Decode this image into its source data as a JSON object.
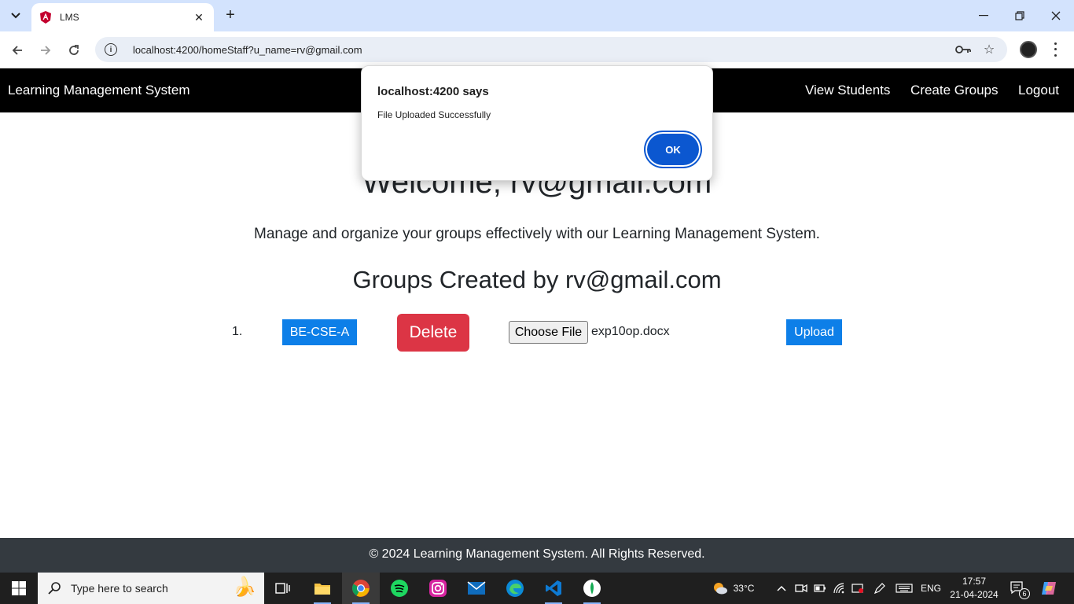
{
  "browser": {
    "tab_title": "LMS",
    "url": "localhost:4200/homeStaff?u_name=rv@gmail.com",
    "icons": [
      "tab-dropdown-icon",
      "angular-favicon-icon",
      "close-icon",
      "plus-icon",
      "minimize-icon",
      "restore-icon",
      "close-window-icon",
      "back-icon",
      "forward-icon",
      "reload-icon",
      "site-info-icon",
      "password-key-icon",
      "bookmark-star-icon",
      "profile-avatar",
      "menu-dots-icon"
    ]
  },
  "navbar": {
    "brand": "Learning Management System",
    "links": [
      "View Students",
      "Create Groups",
      "Logout"
    ]
  },
  "main": {
    "welcome": "Welcome, rv@gmail.com",
    "subtitle": "Manage and organize your groups effectively with our Learning Management System.",
    "groups_heading": "Groups Created by rv@gmail.com",
    "groups": [
      {
        "index": "1.",
        "name": "BE-CSE-A",
        "delete_label": "Delete",
        "choose_file_label": "Choose File",
        "file_name": "exp10op.docx",
        "upload_label": "Upload"
      }
    ]
  },
  "footer": {
    "text": "© 2024 Learning Management System. All Rights Reserved."
  },
  "dialog": {
    "title": "localhost:4200 says",
    "message": "File Uploaded Successfully",
    "ok_label": "OK"
  },
  "taskbar": {
    "search_placeholder": "Type here to search",
    "weather_temp": "33°C",
    "language": "ENG",
    "time": "17:57",
    "date": "21-04-2024",
    "notification_count": "6",
    "apps": [
      "task-view-icon",
      "file-explorer-icon",
      "chrome-icon",
      "spotify-icon",
      "instagram-icon",
      "mail-icon",
      "edge-icon",
      "vscode-icon",
      "mongodb-compass-icon"
    ]
  },
  "colors": {
    "navbar_bg": "#000000",
    "primary_button": "#0d7fe8",
    "danger_button": "#dc3545",
    "footer_bg": "#343a40",
    "dialog_ok": "#0b57d0",
    "tabbar_bg": "#d3e3fd"
  }
}
